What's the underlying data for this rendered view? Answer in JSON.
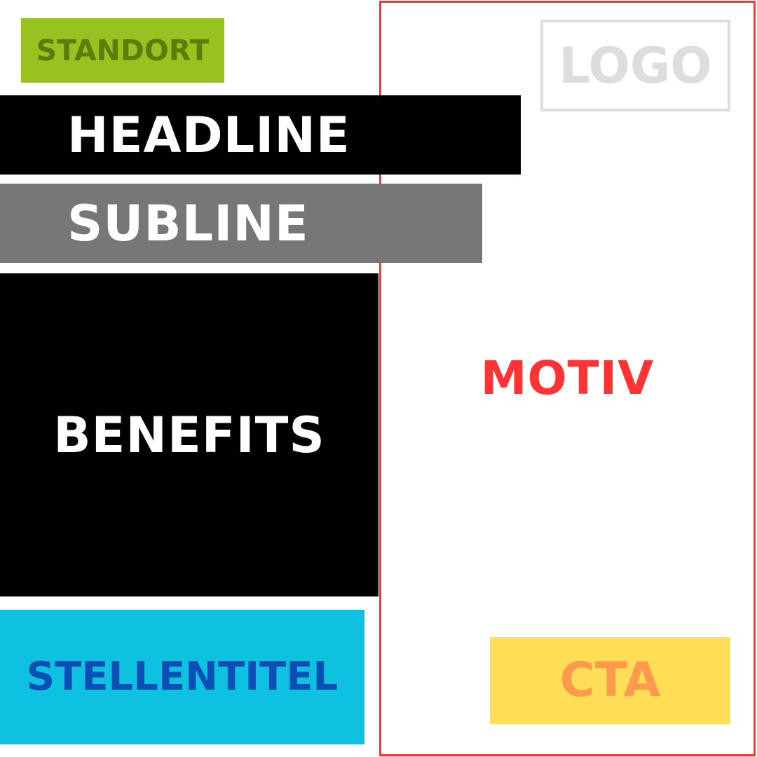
{
  "blocks": {
    "standort": {
      "label": "STANDORT",
      "bg": "#97c21f",
      "fg": "#5e7c0a"
    },
    "logo": {
      "label": "LOGO",
      "bg": "#ffffff",
      "fg": "#dddddd"
    },
    "headline": {
      "label": "HEADLINE",
      "bg": "#000000",
      "fg": "#ffffff"
    },
    "subline": {
      "label": "SUBLINE",
      "bg": "#777777",
      "fg": "#ffffff"
    },
    "benefits": {
      "label": "BENEFITS",
      "bg": "#000000",
      "fg": "#ffffff"
    },
    "stellentitel": {
      "label": "STELLENTITEL",
      "bg": "#0ec1e0",
      "fg": "#0a4fb5"
    },
    "motiv": {
      "label": "MOTIV",
      "bg": "#ffffff",
      "fg": "#ff3333"
    },
    "cta": {
      "label": "CTA",
      "bg": "#ffdd57",
      "fg": "#ff9a4d"
    }
  }
}
